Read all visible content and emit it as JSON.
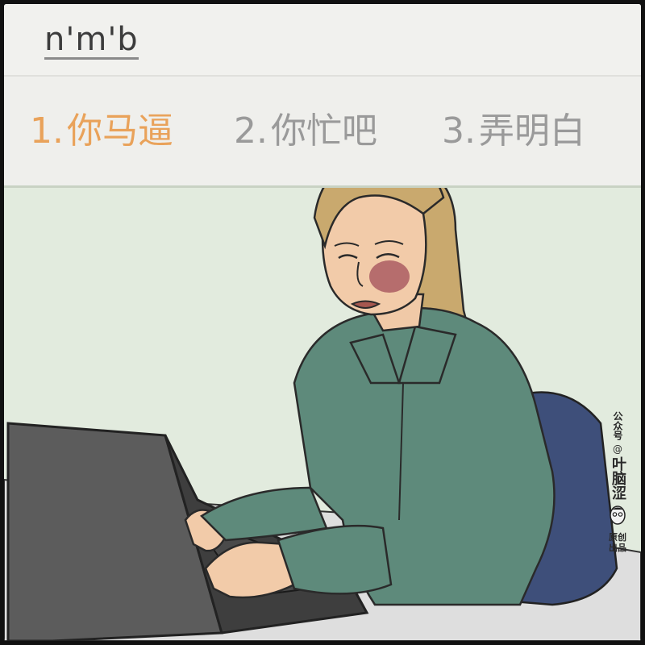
{
  "ime": {
    "composition": "n'm'b",
    "candidates": [
      {
        "number": "1.",
        "text": "你马逼",
        "selected": true
      },
      {
        "number": "2.",
        "text": "你忙吧",
        "selected": false
      },
      {
        "number": "3.",
        "text": "弄明白",
        "selected": false
      }
    ]
  },
  "watermark": {
    "prefix": "公众号",
    "at": "@",
    "name": "叶脑涩",
    "bottom_line1": "原创",
    "bottom_line2": "出品"
  },
  "colors": {
    "selected_candidate": "#e9a25a",
    "normal_candidate": "#9a9a9a",
    "background": "#e3ecdf",
    "shirt": "#5e8a7b",
    "chair": "#3e4f7a",
    "laptop": "#5c5c5c",
    "hair": "#c9a96e"
  }
}
